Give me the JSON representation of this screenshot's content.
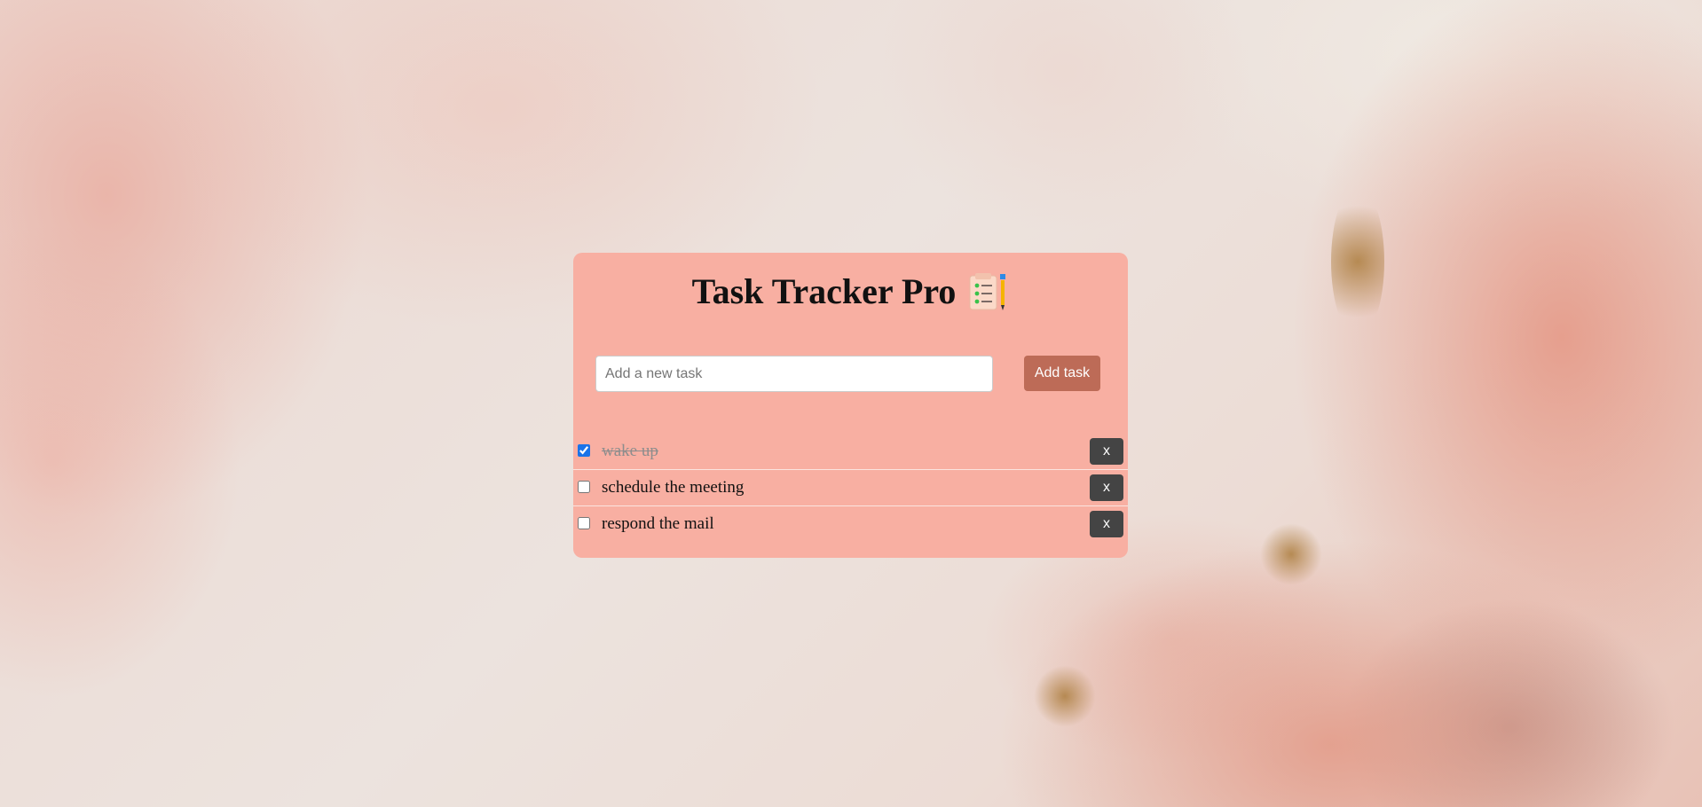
{
  "app": {
    "title": "Task Tracker Pro",
    "title_icon": "clipboard-checklist-icon"
  },
  "form": {
    "placeholder": "Add a new task",
    "value": "",
    "add_label": "Add task"
  },
  "tasks": [
    {
      "text": "wake up",
      "done": true,
      "delete_label": "x"
    },
    {
      "text": "schedule the meeting",
      "done": false,
      "delete_label": "x"
    },
    {
      "text": "respond the mail",
      "done": false,
      "delete_label": "x"
    }
  ],
  "colors": {
    "card": "#f8afa2",
    "add_button": "#bd6b57",
    "delete_button": "#444444",
    "checkbox_accent": "#1a73e8"
  }
}
